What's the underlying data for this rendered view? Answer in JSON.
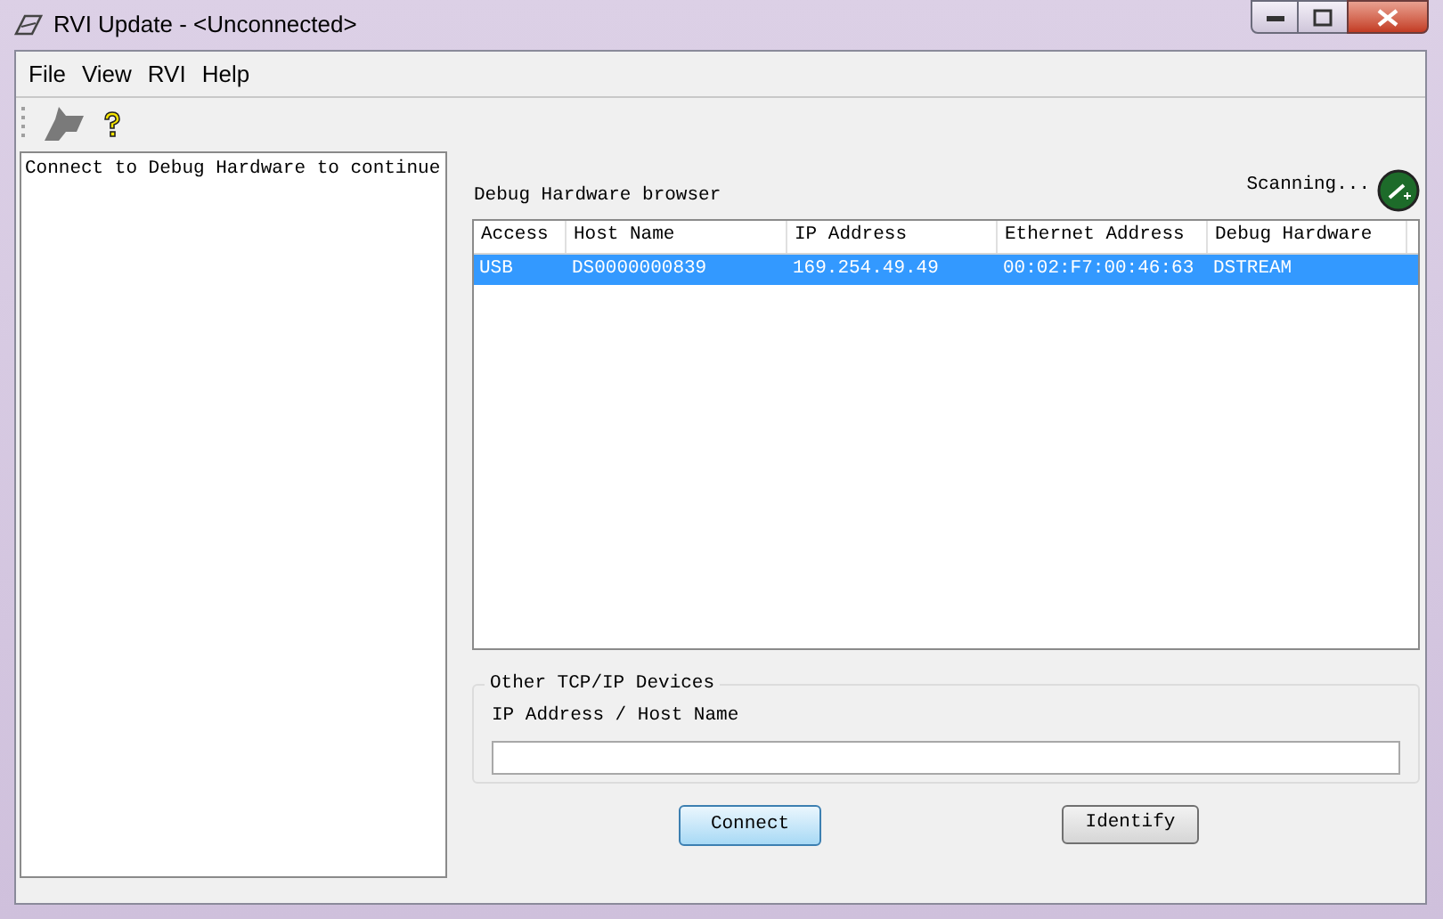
{
  "window": {
    "title": "RVI Update - <Unconnected>"
  },
  "menu": [
    "File",
    "View",
    "RVI",
    "Help"
  ],
  "log": {
    "text": "Connect to Debug Hardware to continue"
  },
  "browser": {
    "title": "Debug Hardware browser",
    "status": "Scanning...",
    "columns": [
      "Access",
      "Host Name",
      "IP Address",
      "Ethernet Address",
      "Debug Hardware"
    ],
    "rows": [
      {
        "cells": [
          "USB",
          "DS0000000839",
          "169.254.49.49",
          "00:02:F7:00:46:63",
          "DSTREAM"
        ],
        "selected": true
      }
    ]
  },
  "other_devices": {
    "title": "Other TCP/IP Devices",
    "field_label": "IP Address / Host Name"
  },
  "buttons": [
    {
      "label": "Connect",
      "focused": true
    },
    {
      "label": "Identify",
      "focused": false
    }
  ]
}
